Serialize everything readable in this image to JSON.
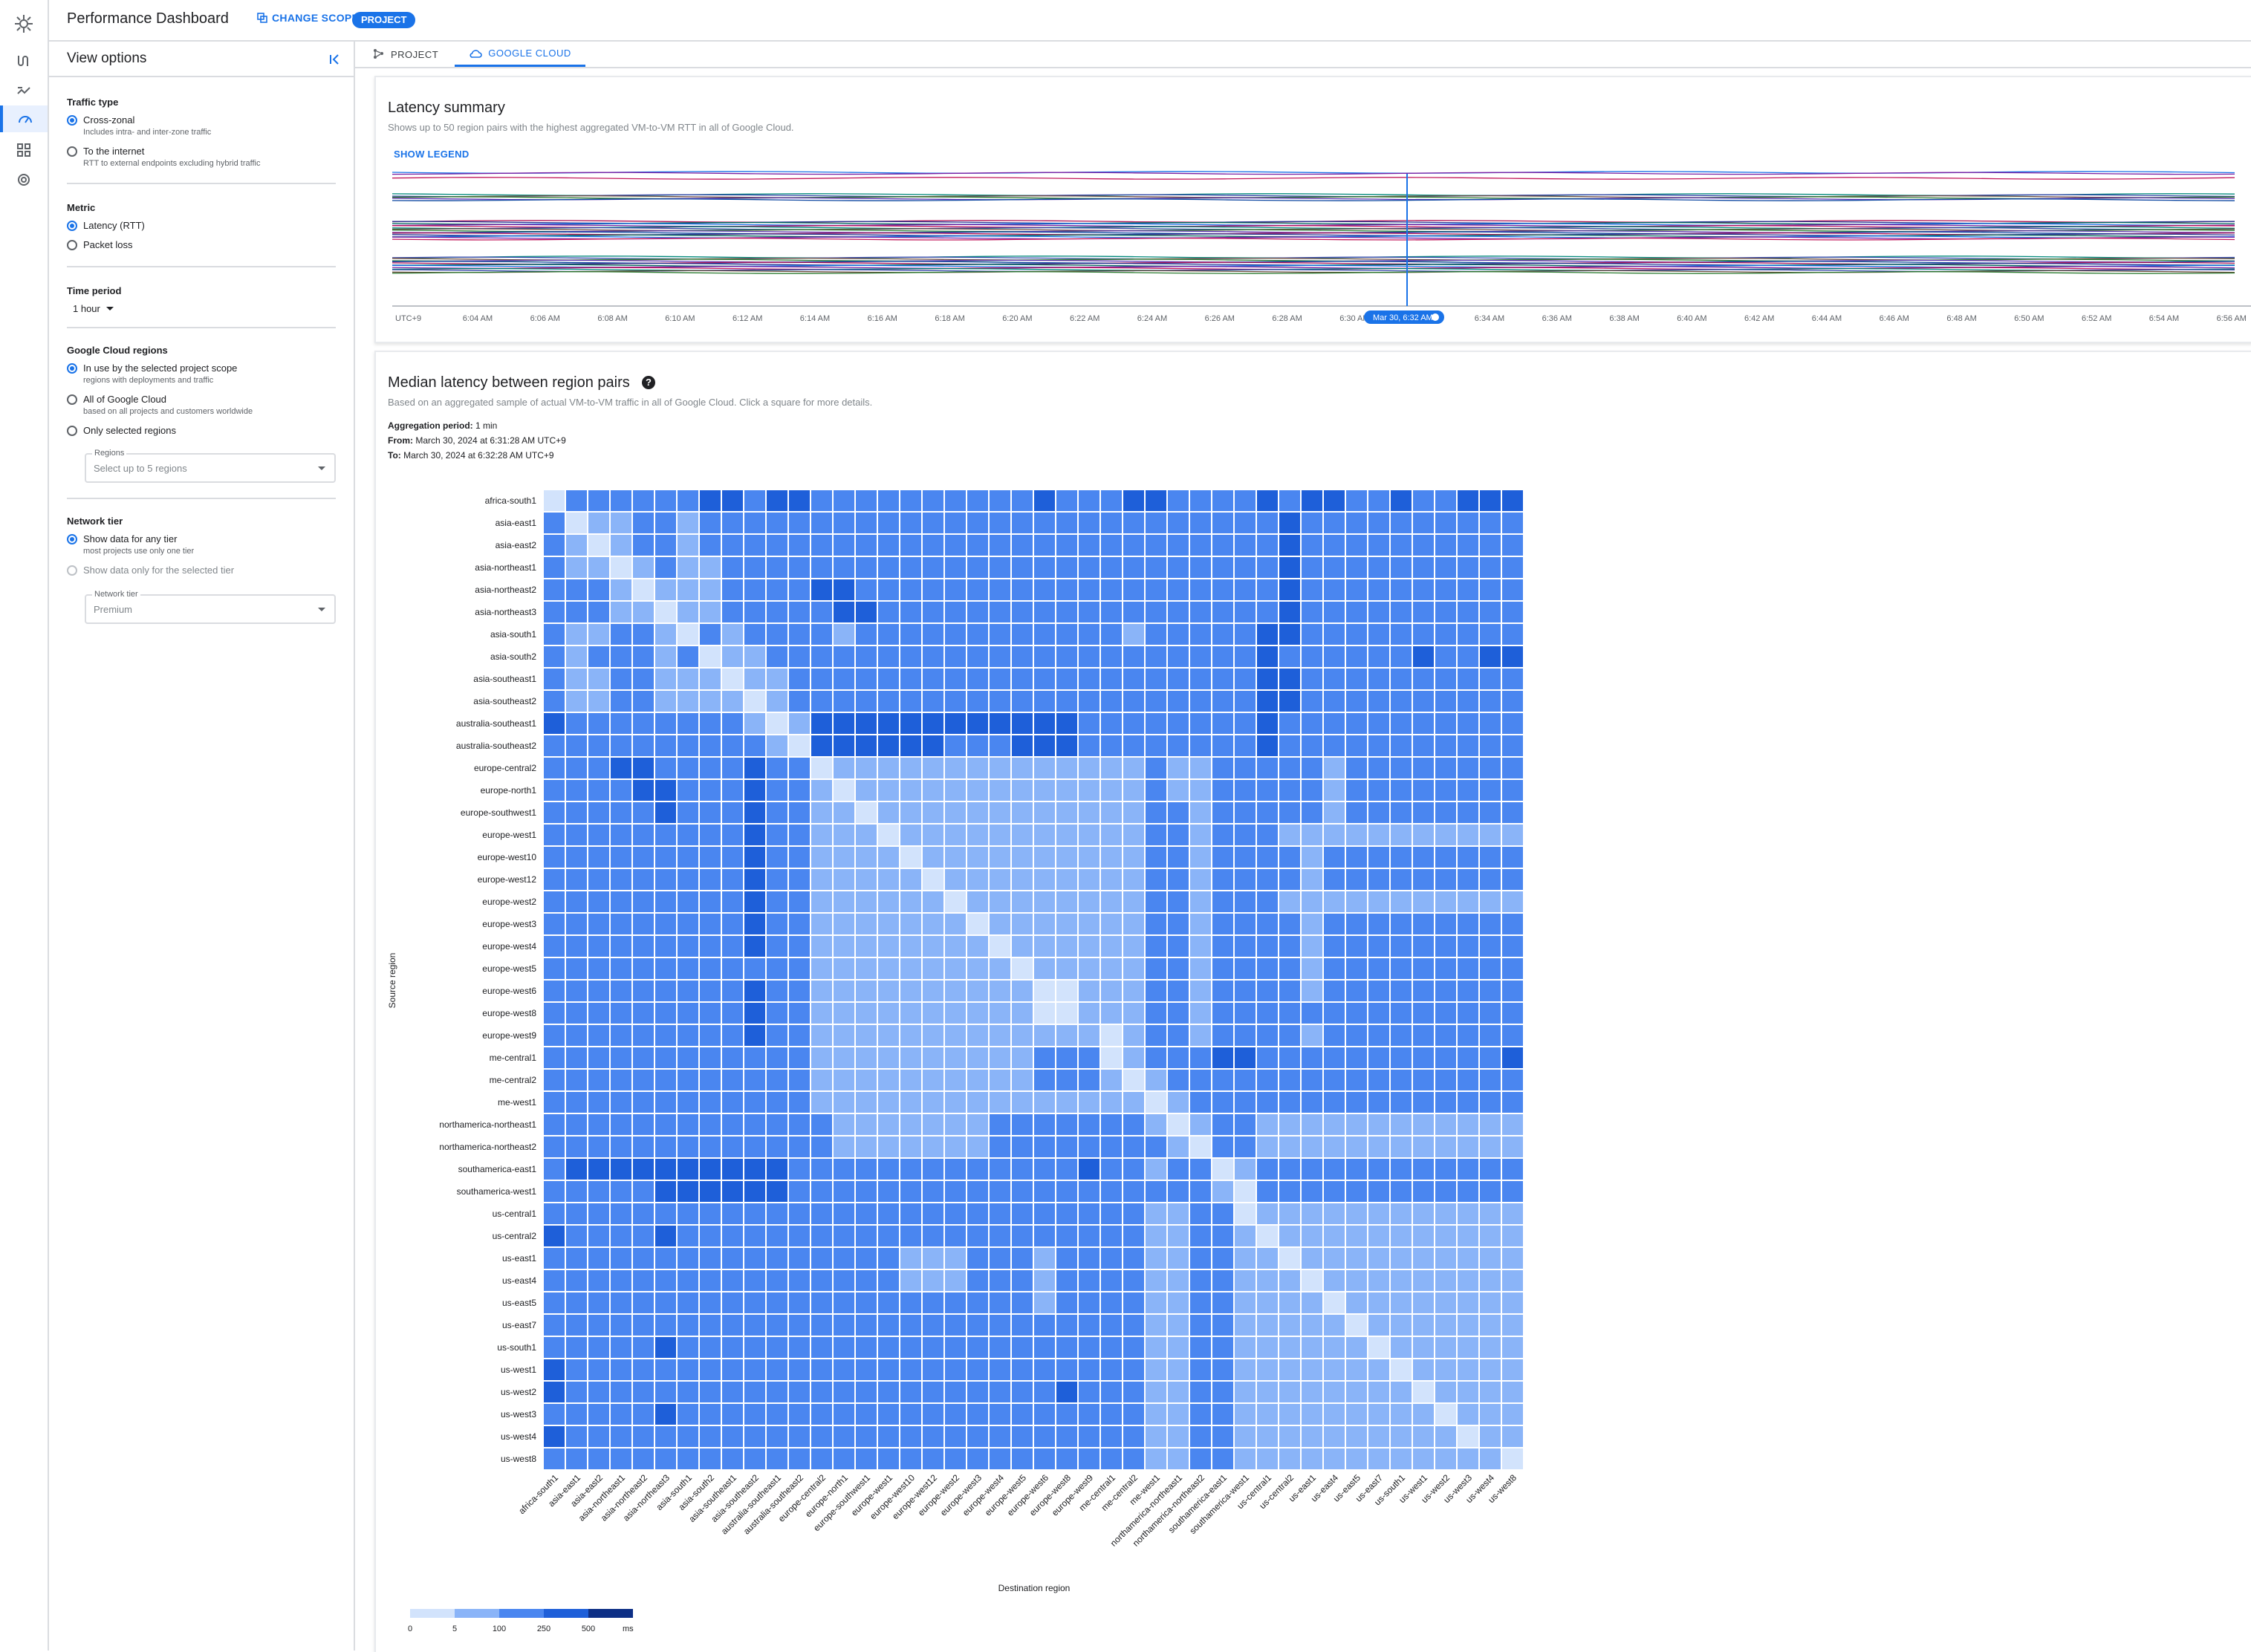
{
  "app": {
    "title": "Performance Dashboard",
    "change_scope_label": "CHANGE SCOPE",
    "scope_chip": "PROJECT"
  },
  "rail": {
    "icons": [
      "logo-icon",
      "flow-icon",
      "network-analyzer-icon",
      "performance-dashboard-icon",
      "topology-icon",
      "monitoring-icon"
    ]
  },
  "left_panel": {
    "title": "View options",
    "traffic": {
      "title": "Traffic type",
      "options": [
        {
          "label": "Cross-zonal",
          "sub": "Includes intra- and inter-zone traffic",
          "selected": true
        },
        {
          "label": "To the internet",
          "sub": "RTT to external endpoints excluding hybrid traffic",
          "selected": false
        }
      ]
    },
    "metric": {
      "title": "Metric",
      "options": [
        {
          "label": "Latency (RTT)",
          "selected": true
        },
        {
          "label": "Packet loss",
          "selected": false
        }
      ]
    },
    "time": {
      "title": "Time period",
      "value": "1 hour"
    },
    "regions": {
      "title": "Google Cloud regions",
      "options": [
        {
          "label": "In use by the selected project scope",
          "sub": "regions with deployments and traffic",
          "selected": true
        },
        {
          "label": "All of Google Cloud",
          "sub": "based on all projects and customers worldwide",
          "selected": false
        },
        {
          "label": "Only selected regions",
          "selected": false
        }
      ],
      "select_label": "Regions",
      "select_placeholder": "Select up to 5 regions"
    },
    "tier": {
      "title": "Network tier",
      "options": [
        {
          "label": "Show data for any tier",
          "sub": "most projects use only one tier",
          "selected": true
        },
        {
          "label": "Show data only for the selected tier",
          "selected": false,
          "disabled": true
        }
      ],
      "select_label": "Network tier",
      "select_value": "Premium"
    }
  },
  "tabs": [
    {
      "label": "PROJECT",
      "active": false
    },
    {
      "label": "GOOGLE CLOUD",
      "active": true
    }
  ],
  "summary": {
    "title": "Latency summary",
    "subtitle": "Shows up to 50 region pairs with the highest aggregated VM-to-VM RTT in all of Google Cloud.",
    "show_legend": "SHOW LEGEND",
    "x_labels": [
      "UTC+9",
      "6:04 AM",
      "6:06 AM",
      "6:08 AM",
      "6:10 AM",
      "6:12 AM",
      "6:14 AM",
      "6:16 AM",
      "6:18 AM",
      "6:20 AM",
      "6:22 AM",
      "6:24 AM",
      "6:26 AM",
      "6:28 AM",
      "6:30 AM",
      "6:32 AM",
      "6:34 AM",
      "6:36 AM",
      "6:38 AM",
      "6:40 AM",
      "6:42 AM",
      "6:44 AM",
      "6:46 AM",
      "6:48 AM",
      "6:50 AM",
      "6:52 AM",
      "6:54 AM",
      "6:56 AM"
    ],
    "cursor_label": "Mar 30, 6:32 AM"
  },
  "heatmap": {
    "title": "Median latency between region pairs",
    "subtitle": "Based on an aggregated sample of actual VM-to-VM traffic in all of Google Cloud. Click a square for more details.",
    "aggregation_label": "Aggregation period:",
    "aggregation_value": "1 min",
    "from_label": "From:",
    "from_value": "March 30, 2024 at 6:31:28 AM UTC+9",
    "to_label": "To:",
    "to_value": "March 30, 2024 at 6:32:28 AM UTC+9"
  },
  "chart_data": {
    "type": "heatmap",
    "title": "Median latency between region pairs",
    "xlabel": "Destination region",
    "ylabel": "Source region",
    "regions": [
      "africa-south1",
      "asia-east1",
      "asia-east2",
      "asia-northeast1",
      "asia-northeast2",
      "asia-northeast3",
      "asia-south1",
      "asia-south2",
      "asia-southeast1",
      "asia-southeast2",
      "australia-southeast1",
      "australia-southeast2",
      "europe-central2",
      "europe-north1",
      "europe-southwest1",
      "europe-west1",
      "europe-west10",
      "europe-west12",
      "europe-west2",
      "europe-west3",
      "europe-west4",
      "europe-west5",
      "europe-west6",
      "europe-west8",
      "europe-west9",
      "me-central1",
      "me-central2",
      "me-west1",
      "northamerica-northeast1",
      "northamerica-northeast2",
      "southamerica-east1",
      "southamerica-west1",
      "us-central1",
      "us-central2",
      "us-east1",
      "us-east4",
      "us-east5",
      "us-east7",
      "us-south1",
      "us-west1",
      "us-west2",
      "us-west3",
      "us-west4",
      "us-west8"
    ],
    "scale": {
      "thresholds": [
        0,
        5,
        100,
        250,
        500
      ],
      "unit": "ms",
      "colors": [
        "#d2e3fc",
        "#8ab4f8",
        "#4a86f0",
        "#1e5fd9",
        "#0d2f86"
      ]
    },
    "bins": [
      "02222223323322222222223222332222323322322333",
      "20112212222222222222222222222222232222222222",
      "21012212222222222222222222222222232222222222",
      "21101211222222222222222222222222232222222222",
      "22210111222233222222222222222222232222222222",
      "22211011222223322222222222222222232222222222",
      "21122102122221222222222222122222332222222222",
      "21222120112222222222222222222222322222232233",
      "21122111011222222222222222222222332222222222",
      "21122111101222222222222222222222332222222222",
      "32222222210133333333333322222222322222222222",
      "22222222221033333322233322222222322222222222",
      "22233222232201111111111111121122222122222222",
      "22223322232210111111111111121122222122222222",
      "22222322232211011111111111122122222122222222",
      "22222222232211101111111111122122211111111111",
      "22222222232211110111111111122122221222222222",
      "22222222232211111011111111122122221222222222",
      "22222222232211111101111111122122211111111111",
      "22222222232211111110111111122122221222222222",
      "22222222232211111111011111122122221222222222",
      "22222222222211111111101111122122221222222222",
      "22222222232211111111110011122122221222222222",
      "22222222232211111111110011122122222222222222",
      "22222222232211111111111110122122221222222222",
      "22222222222211111111112220122233222222222223",
      "22222222222211111111112221012222222222222222",
      "22222222222211111111111111101222222222222222",
      "22222222222221111111222222210122111111111111",
      "22222222222221111111222222221022111111111111",
      "23333333333222222222222232212201222222222222",
      "22222333333222222222222222222210222222222222",
      "22222222222222222222222222211220111111111111",
      "32222322222222222222222222211221011111111111",
      "22222222222222221112221222211221101111111111",
      "22222222222222221112221222211221110111111111",
      "22222222222222222222221222211221111011111111",
      "22222222222222222222222222211221111101111111",
      "22222322222222222222222222211221111110111111",
      "32222222222222222222222222211221111111011111",
      "32222222222222222222222322211221111111101111",
      "22222322222222222222222222211221111111110111",
      "32222222222222222222222222211221111111111011",
      "22222222222222222222222222211221111111111110"
    ]
  }
}
